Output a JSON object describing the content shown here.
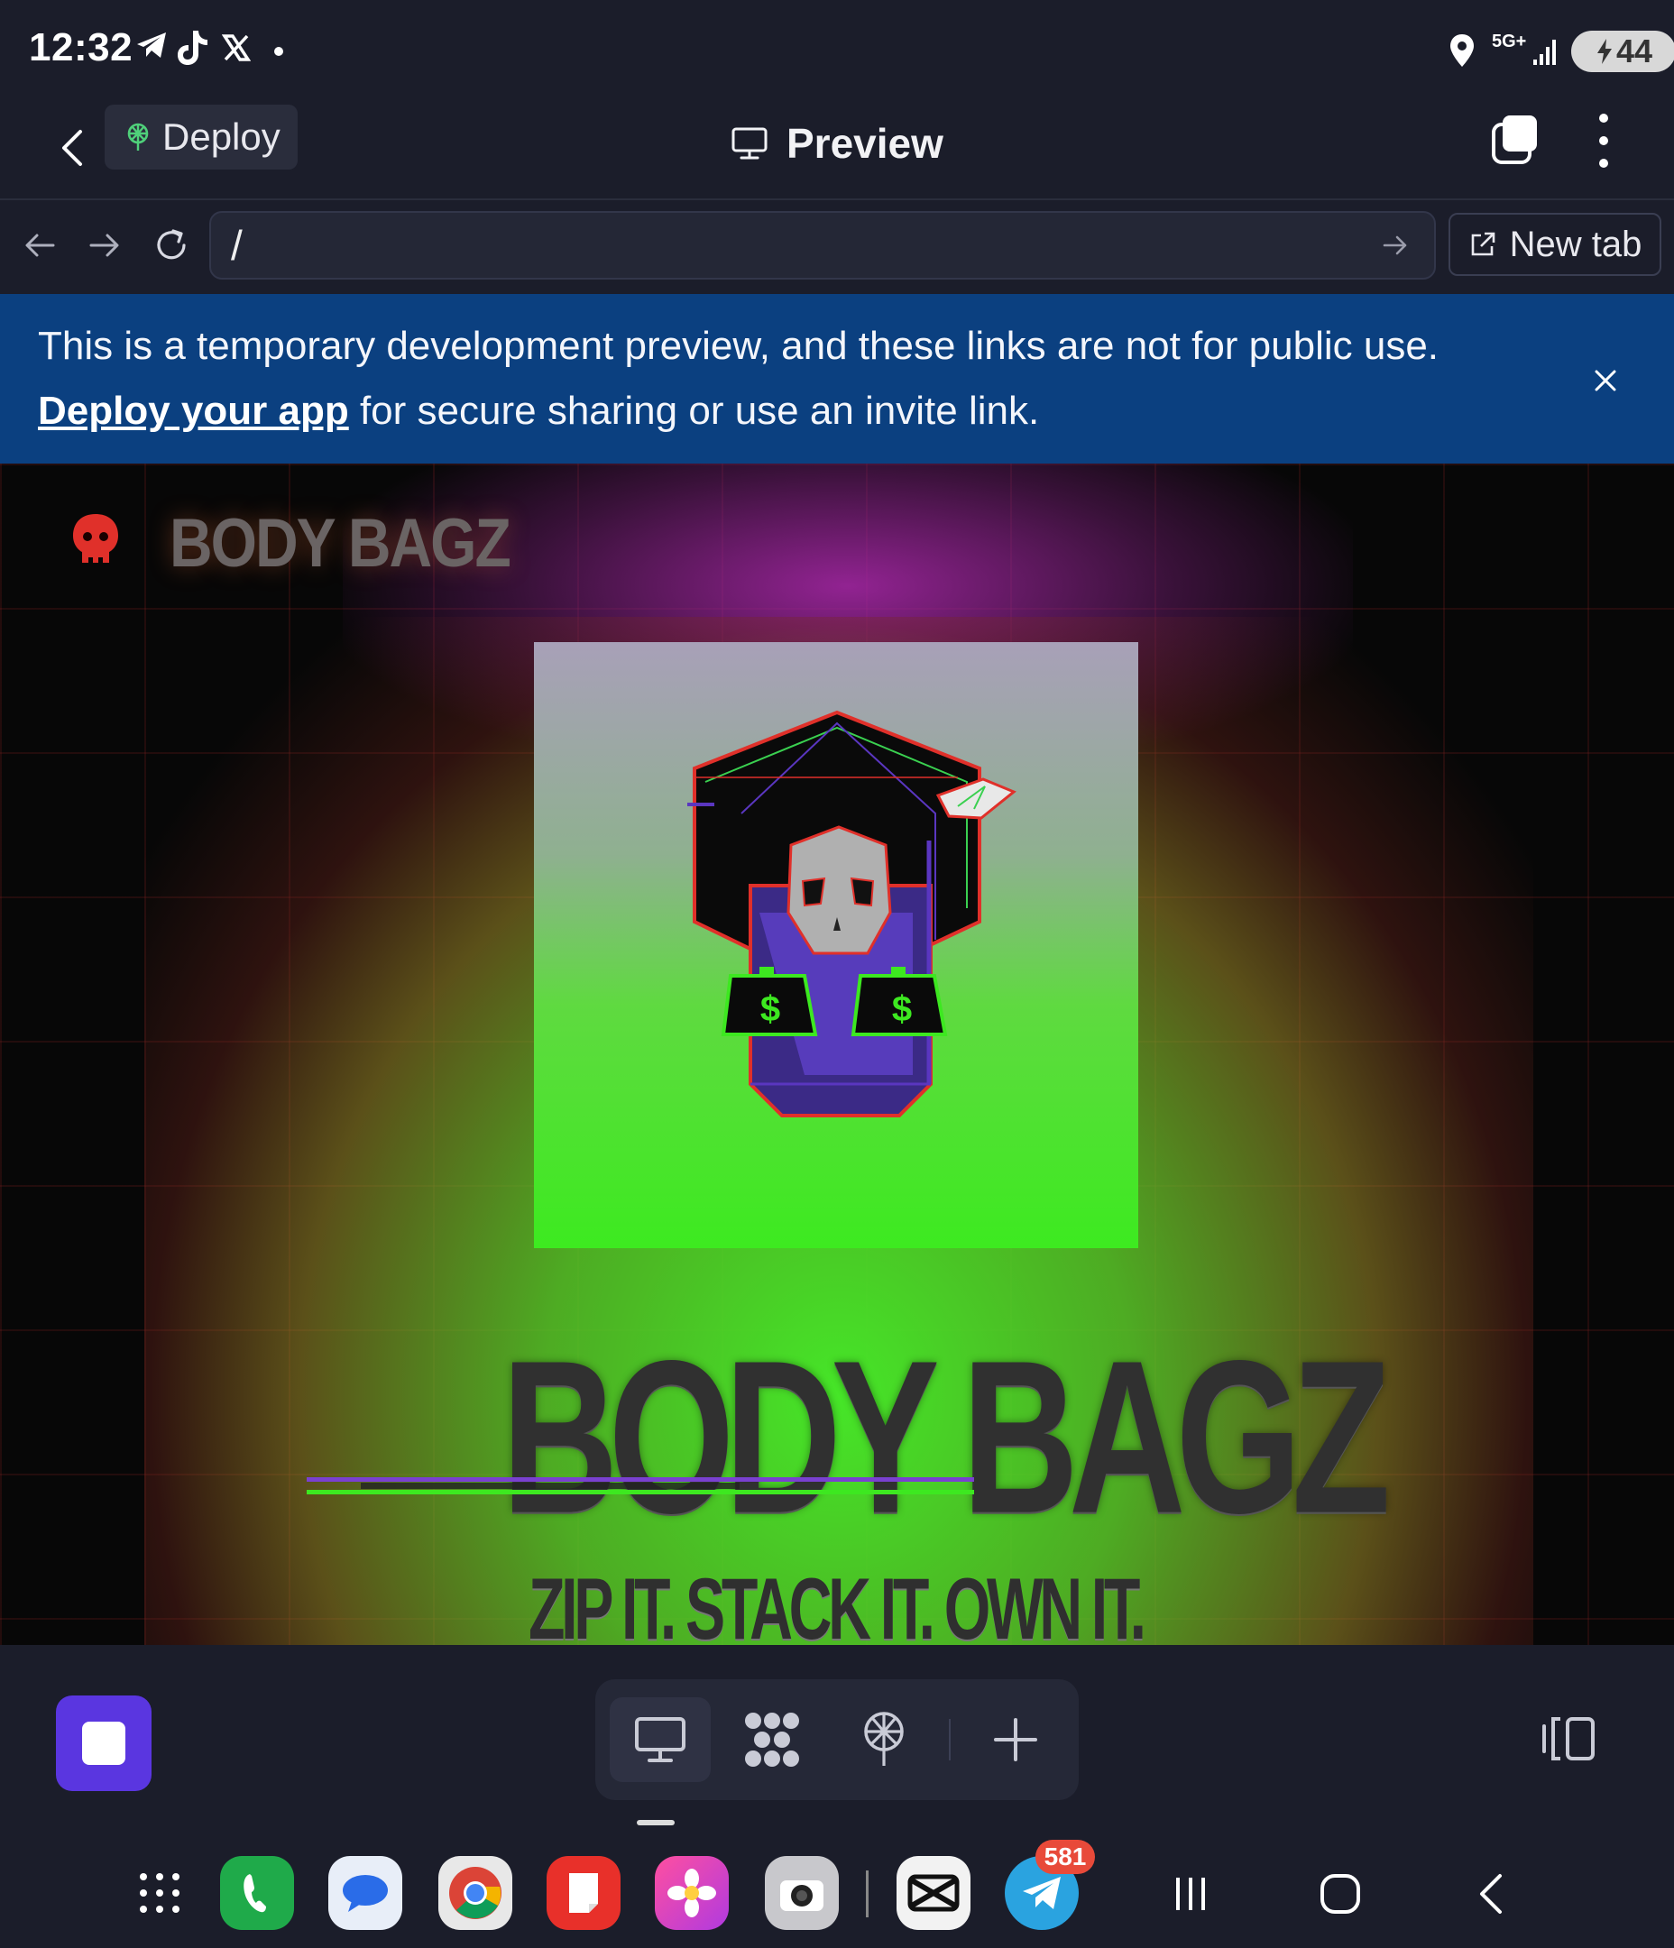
{
  "status_bar": {
    "time": "12:32",
    "left_icons": [
      "telegram-icon",
      "tiktok-icon",
      "x-icon",
      "dot-icon"
    ],
    "right_icons": [
      "location-icon",
      "5g-icon",
      "signal-icon"
    ],
    "network": "5G+",
    "battery": "44"
  },
  "header": {
    "deploy_label": "Deploy",
    "title": "Preview"
  },
  "url_bar": {
    "url": "/",
    "new_tab_label": "New tab"
  },
  "banner": {
    "text_before": "This is a temporary development preview, and these links are not for public use.",
    "link_text": "Deploy your app",
    "text_after": "for secure sharing or use an invite link."
  },
  "site": {
    "logo_text": "BODY BAGZ",
    "hero_title": "BODY BAGZ",
    "tagline": "ZIP IT. STACK IT. OWN IT.",
    "bag_symbols": [
      "$",
      "$"
    ],
    "colors": {
      "accent_green": "#3de820",
      "accent_purple": "#a030a0",
      "skull_red": "#e0302a"
    }
  },
  "toolbar": {
    "tools": [
      "monitor-icon",
      "workspace-icon",
      "deploy-icon",
      "plus-icon"
    ],
    "stop_color": "#5a36e0"
  },
  "dock": {
    "apps": [
      "apps-grid-icon",
      "phone-app",
      "messages-app",
      "chrome-app",
      "notes-app",
      "gallery-app",
      "camera-app",
      "capcut-app",
      "telegram-app"
    ],
    "telegram_badge": "581"
  }
}
